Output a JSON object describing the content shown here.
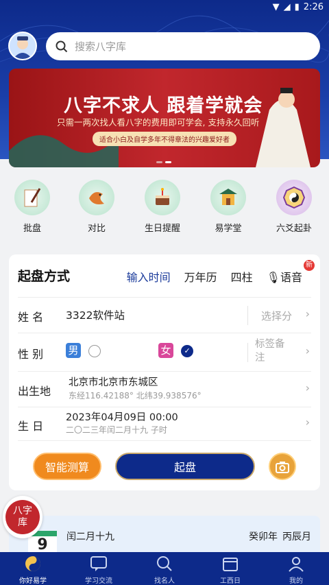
{
  "status_bar": {
    "time": "2:26"
  },
  "search": {
    "placeholder": "搜索八字库"
  },
  "banner": {
    "title": "八字不求人  跟着学就会",
    "subtitle": "只需一两次找人看八字的费用即可学会, 支持永久回听",
    "tag": "适合小白及自学多年不得章法的兴趣爱好者"
  },
  "menu": [
    {
      "label": "批盘",
      "icon": "paper-brush-icon"
    },
    {
      "label": "对比",
      "icon": "koi-fish-icon"
    },
    {
      "label": "生日提醒",
      "icon": "cake-icon"
    },
    {
      "label": "易学堂",
      "icon": "temple-icon"
    },
    {
      "label": "六爻起卦",
      "icon": "bagua-icon"
    }
  ],
  "form": {
    "title": "起盘方式",
    "tabs": [
      "输入时间",
      "万年历",
      "四柱",
      "语音"
    ],
    "new_badge": "新",
    "name_label": "姓 名",
    "name_value": "3322软件站",
    "name_right": "选择分",
    "gender_label": "性 别",
    "male": "男",
    "female": "女",
    "gender_right": "标签备注",
    "birthplace_label": "出生地",
    "birthplace_value": "北京市北京市东城区",
    "birthplace_coords": "东经116.42188° 北纬39.938576°",
    "birthday_label": "生 日",
    "birthday_value": "2023年04月09日 00:00",
    "birthday_lunar": "二〇二三年闰二月十九 子时",
    "smart_button": "智能测算",
    "start_button": "起盘"
  },
  "float_badge": "八字库",
  "calendar": {
    "lunar": "闰二月十九",
    "year": "癸卯年",
    "month": "丙辰月",
    "day": "9"
  },
  "tabbar": [
    "你好易学",
    "学习交流",
    "找名人",
    "工西日",
    "我的"
  ],
  "colors": {
    "primary": "#0d2a8a",
    "accent": "#f08a1e",
    "red": "#c1272d"
  }
}
